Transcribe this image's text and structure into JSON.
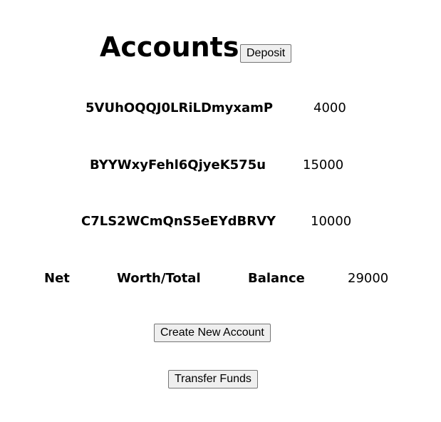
{
  "header": {
    "title": "Accounts",
    "deposit_label": "Deposit"
  },
  "accounts": [
    {
      "id": "5VUhOQQJ0LRiLDmyxamP",
      "balance": "4000"
    },
    {
      "id": "BYYWxyFehl6QjyeK575u",
      "balance": "15000"
    },
    {
      "id": "C7LS2WCmQnS5eEYdBRVY",
      "balance": "10000"
    }
  ],
  "summary": {
    "label_words": [
      "Net",
      "Worth/Total",
      "Balance"
    ],
    "value": "29000"
  },
  "actions": {
    "create_label": "Create New Account",
    "transfer_label": "Transfer Funds"
  }
}
